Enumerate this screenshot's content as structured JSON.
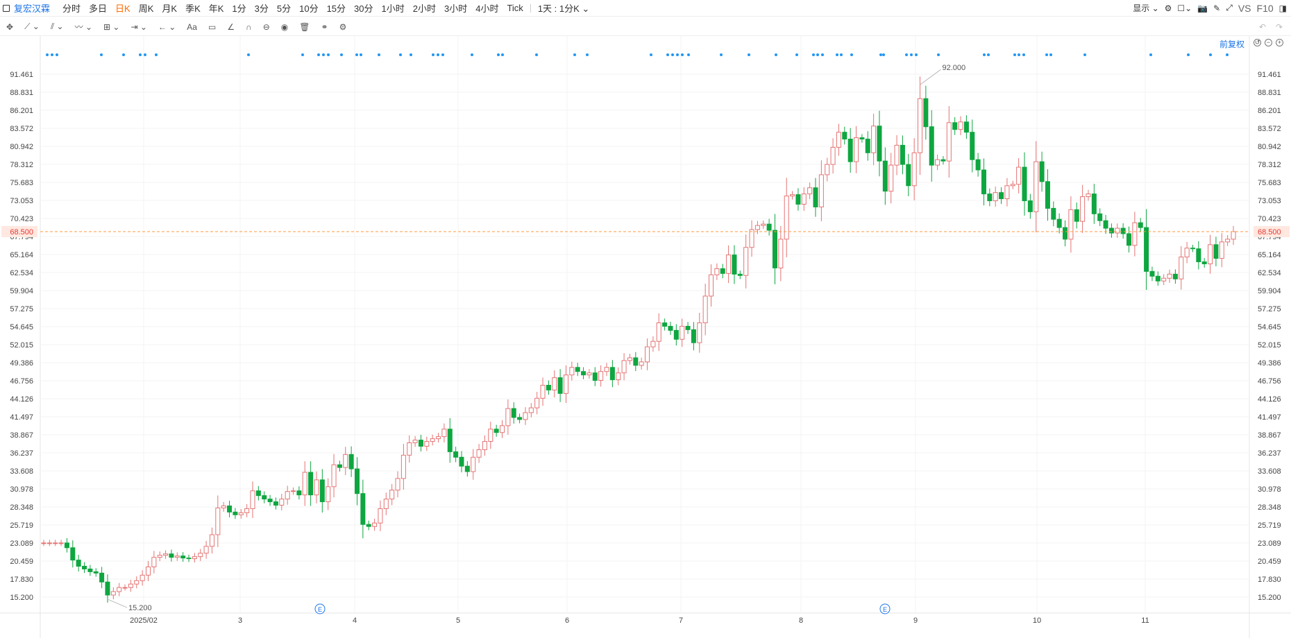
{
  "stock_name": "复宏汉霖",
  "periods": [
    "分时",
    "多日",
    "日K",
    "周K",
    "月K",
    "季K",
    "年K",
    "1分",
    "3分",
    "5分",
    "10分",
    "15分",
    "30分",
    "1小时",
    "2小时",
    "3小时",
    "4小时",
    "Tick"
  ],
  "active_period": "日K",
  "interval_select": "1天 : 1分K",
  "display_label": "显示",
  "vs_label": "VS",
  "f10_label": "F10",
  "adjust_label": "前复权",
  "toolbar_icons": [
    "move-icon",
    "line-icon",
    "channel-icon",
    "wave-icon",
    "measure-icon",
    "range-icon",
    "arrow-icon",
    "text-icon",
    "comment-icon",
    "angle-icon",
    "arc-icon",
    "cycle-icon",
    "target-icon",
    "trash-icon",
    "link-icon",
    "settings-icon"
  ],
  "chart_data": {
    "type": "candlestick",
    "y_ticks": [
      "91.461",
      "88.831",
      "86.201",
      "83.572",
      "80.942",
      "78.312",
      "75.683",
      "73.053",
      "70.423",
      "67.794",
      "65.164",
      "62.534",
      "59.904",
      "57.275",
      "54.645",
      "52.015",
      "49.386",
      "46.756",
      "44.126",
      "41.497",
      "38.867",
      "36.237",
      "33.608",
      "30.978",
      "28.348",
      "25.719",
      "23.089",
      "20.459",
      "17.830",
      "15.200"
    ],
    "x_labels": [
      "2025/02",
      "3",
      "4",
      "5",
      "6",
      "7",
      "8",
      "9",
      "10",
      "11"
    ],
    "ylim": [
      15.2,
      91.461
    ],
    "last_price": "68.500",
    "max_label": "92.000",
    "min_label": "15.200",
    "event_marker": "E",
    "up_color": "#e57373",
    "down_color": "#0ea640",
    "price_line_color": "#ff9a3c",
    "closes": [
      23.1,
      23.1,
      23.1,
      23.1,
      22.4,
      20.6,
      19.7,
      19.3,
      18.9,
      18.7,
      17.4,
      15.5,
      16.0,
      16.6,
      16.6,
      17.1,
      17.6,
      18.4,
      19.6,
      21.0,
      21.3,
      21.5,
      21.0,
      21.2,
      20.9,
      20.8,
      21.1,
      21.6,
      22.6,
      24.3,
      28.2,
      28.5,
      27.6,
      27.2,
      27.5,
      28.1,
      30.7,
      30.0,
      29.5,
      29.1,
      28.6,
      29.5,
      30.6,
      30.7,
      30.1,
      33.4,
      30.1,
      32.3,
      29.1,
      31.3,
      34.5,
      34.1,
      36.0,
      33.9,
      30.3,
      25.8,
      25.5,
      26.0,
      28.1,
      29.5,
      30.8,
      32.5,
      35.9,
      37.7,
      38.1,
      37.2,
      37.9,
      38.3,
      38.6,
      39.7,
      36.4,
      35.6,
      34.3,
      33.5,
      35.6,
      36.7,
      37.9,
      39.7,
      39.2,
      40.2,
      42.7,
      41.4,
      41.1,
      42.1,
      42.8,
      44.2,
      46.1,
      45.4,
      47.2,
      44.9,
      47.6,
      48.7,
      48.1,
      47.6,
      47.9,
      46.8,
      48.1,
      48.7,
      46.9,
      47.9,
      49.7,
      50.1,
      49.0,
      49.5,
      51.7,
      52.5,
      55.2,
      54.7,
      54.1,
      52.8,
      54.7,
      54.2,
      52.3,
      55.2,
      59.1,
      62.2,
      63.1,
      62.4,
      65.1,
      62.3,
      62.1,
      66.2,
      68.8,
      69.4,
      69.6,
      68.7,
      63.2,
      67.4,
      73.7,
      73.9,
      72.5,
      74.0,
      74.9,
      72.1,
      76.8,
      78.3,
      80.8,
      83.0,
      82.0,
      78.7,
      82.2,
      82.0,
      80.0,
      83.9,
      78.8,
      74.4,
      78.2,
      81.1,
      78.3,
      75.2,
      80.0,
      87.9,
      83.8,
      78.2,
      79.0,
      78.8,
      84.4,
      83.4,
      84.5,
      83.0,
      79.0,
      77.5,
      74.0,
      73.0,
      74.2,
      73.3,
      75.2,
      75.4,
      77.9,
      73.0,
      71.4,
      78.7,
      75.8,
      71.9,
      70.3,
      69.1,
      67.4,
      71.7,
      70.0,
      73.6,
      74.0,
      71.1,
      70.1,
      69.0,
      68.3,
      69.0,
      68.2,
      66.5,
      69.8,
      69.1,
      62.7,
      62.0,
      61.3,
      61.7,
      62.3,
      61.6,
      64.8,
      66.1,
      66.0,
      64.1,
      63.8,
      66.6,
      64.6,
      67.0,
      67.4,
      68.5
    ]
  }
}
